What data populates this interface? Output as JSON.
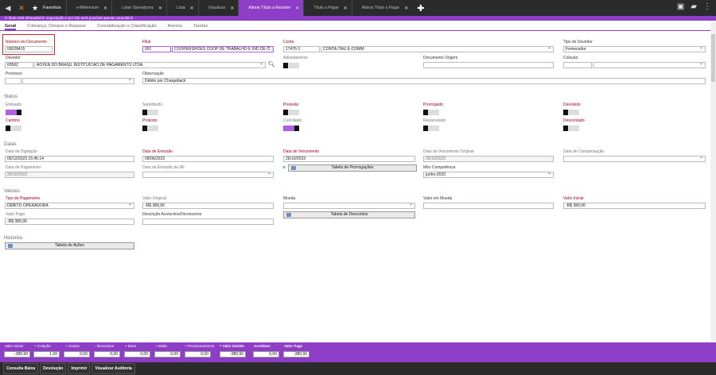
{
  "topbar": {
    "favorites": "Favoritos",
    "tabs": [
      "e-Millennium",
      "Listar Operadores",
      "Lista",
      "Visualizar",
      "Alterar Título a Receber",
      "Título a Pagar",
      "Alterar Título a Pagar"
    ]
  },
  "notice": "O título está efetuado/em negociação e por isto será possível apenas consultá-lo",
  "subtabs": [
    "Geral",
    "Cobrança, Cheque e Repasse",
    "Contabilização e Classificação",
    "Anexos",
    "Tarefas"
  ],
  "form": {
    "numero_documento": {
      "label": "Número do Documento",
      "value": "00028415"
    },
    "filial": {
      "label": "Filial",
      "code": "001",
      "value": "COOPERSHOES COOP DE TRABALHO E IND DE C..."
    },
    "conta": {
      "label": "Conta",
      "code": "17476-1",
      "value": "CONTA ITAU E-COMM"
    },
    "tipo_devedor": {
      "label": "Tipo de Devedor",
      "value": "Fornecedor"
    },
    "devedor": {
      "label": "Devedor",
      "code": "00562",
      "value": "ADYEN DO BRASIL INSTITUICAO DE PAGAMENTO LTDA."
    },
    "adiantamento": "Adiantamento",
    "documento_origem": "Documento Origem",
    "colecao": "Coleção",
    "processo": "Processo",
    "observacao": {
      "label": "Observação",
      "value": "Débito por Chargeback"
    }
  },
  "status": {
    "title": "Status",
    "items": [
      "Efetuado",
      "Substituído",
      "Previsão",
      "Prorrogado",
      "Devolvido",
      "Cartório",
      "Protesto",
      "Conciliado",
      "Reparcelado",
      "Descontado"
    ]
  },
  "datas": {
    "title": "Datas",
    "digitacao": {
      "label": "Data de Digitação",
      "value": "05/12/2023 15:45:14"
    },
    "emissao": {
      "label": "Data de Emissão",
      "value": "09/06/2023"
    },
    "vencimento": {
      "label": "Data de Vencimento",
      "value": "26/10/2023"
    },
    "venc_original": {
      "label": "Data de Vencimento Original",
      "value": "26/10/2023"
    },
    "compensacao": {
      "label": "Data de Compensação",
      "value": ""
    },
    "pagamento": {
      "label": "Data de Pagamento",
      "value": "26/10/2023"
    },
    "emissao_nf": {
      "label": "Data de Emissão da NF",
      "value": ""
    },
    "tabela_prorrogacoes": "Tabela de Prorrogações",
    "mes_competencia": {
      "label": "Mês Competência",
      "value": "junho-2023"
    }
  },
  "valores": {
    "title": "Valores",
    "tipo_pagamento": {
      "label": "Tipo de Pagamento",
      "value": "DEBITO OPERADORA"
    },
    "valor_original": {
      "label": "Valor Original",
      "value": "-R$ 389,90"
    },
    "moeda": {
      "label": "Moeda",
      "value": ""
    },
    "valor_moeda": {
      "label": "Valor em Moeda",
      "value": ""
    },
    "valor_inicial": {
      "label": "Valor Inicial",
      "value": "-R$ 389,90"
    },
    "valor_pago": {
      "label": "Valor Pago",
      "value": "-R$ 389,90"
    },
    "desc_acrescimo": {
      "label": "Descrição Acréscimo/Decréscimo",
      "value": ""
    },
    "tabela_descontos": "Tabela de Descontos"
  },
  "historico": {
    "title": "Histórico",
    "tabela_acoes": "Tabela de Ações"
  },
  "bottom": {
    "labels": [
      "Valor Inicial",
      "+ Cotação",
      "+ Custos",
      "- Descontos",
      "+ Mora",
      "+ Multa",
      "+ Provisionamento",
      "= Valor Devido",
      "Acre/Decr",
      "Valor Pago"
    ],
    "values": [
      "-389,90",
      "1,00",
      "0,00",
      "0,00",
      "0,00",
      "0,00",
      "0,00",
      "-389,90",
      "0,00",
      "-389,90"
    ]
  },
  "footer": [
    "Consulta Baixa",
    "Devolução",
    "Imprimir",
    "Visualizar Auditoria"
  ]
}
